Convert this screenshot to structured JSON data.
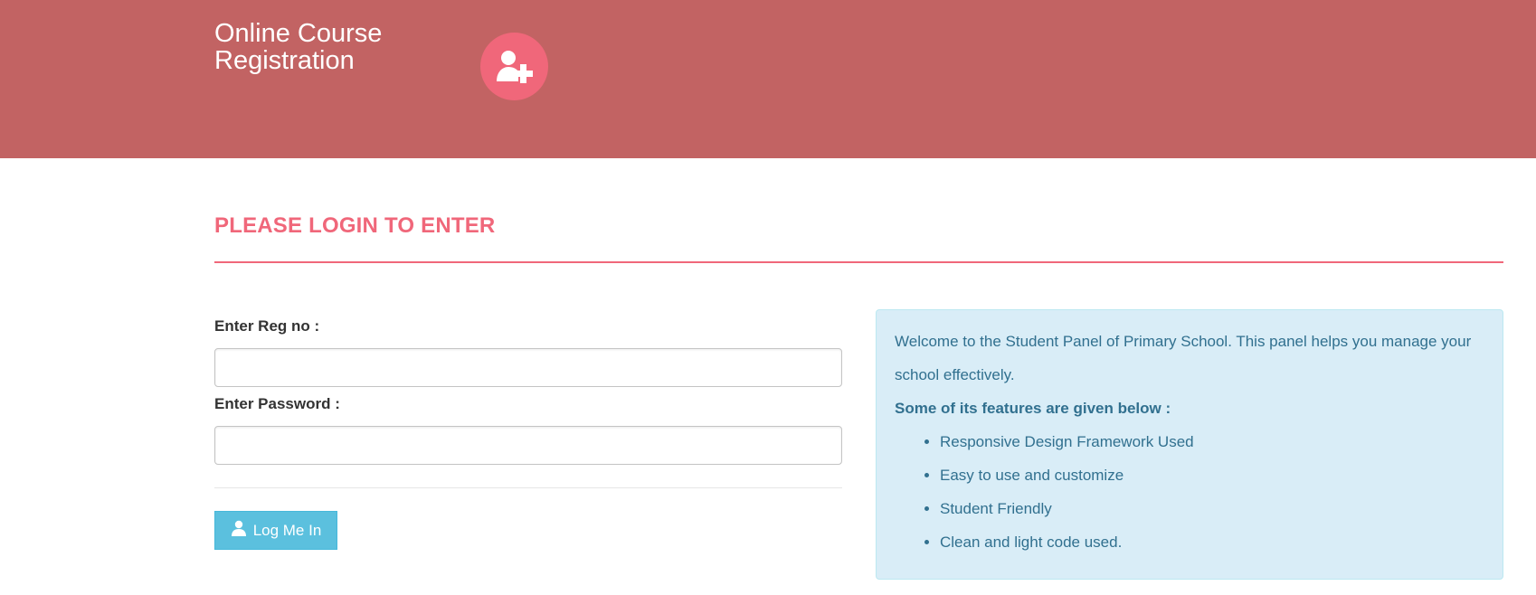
{
  "header": {
    "title_line1": "Online Course",
    "title_line2": "Registration",
    "icon": "user-plus-icon",
    "background_color": "#c26363",
    "icon_color": "#f0677a"
  },
  "main": {
    "heading": "PLEASE LOGIN TO ENTER",
    "accent_color": "#f0677a"
  },
  "form": {
    "reg_label": "Enter Reg no :",
    "reg_value": "",
    "password_label": "Enter Password :",
    "password_value": "",
    "login_button_label": "Log Me In",
    "login_button_icon": "user-icon",
    "button_color": "#5bc0de"
  },
  "info_panel": {
    "welcome_text": "Welcome to the Student Panel of Primary School. This panel helps you manage your school effectively.",
    "features_title": "Some of its features are given below :",
    "features": [
      "Responsive Design Framework Used",
      "Easy to use and customize",
      "Student Friendly",
      "Clean and light code used."
    ],
    "background_color": "#d9edf7",
    "text_color": "#31708f"
  }
}
